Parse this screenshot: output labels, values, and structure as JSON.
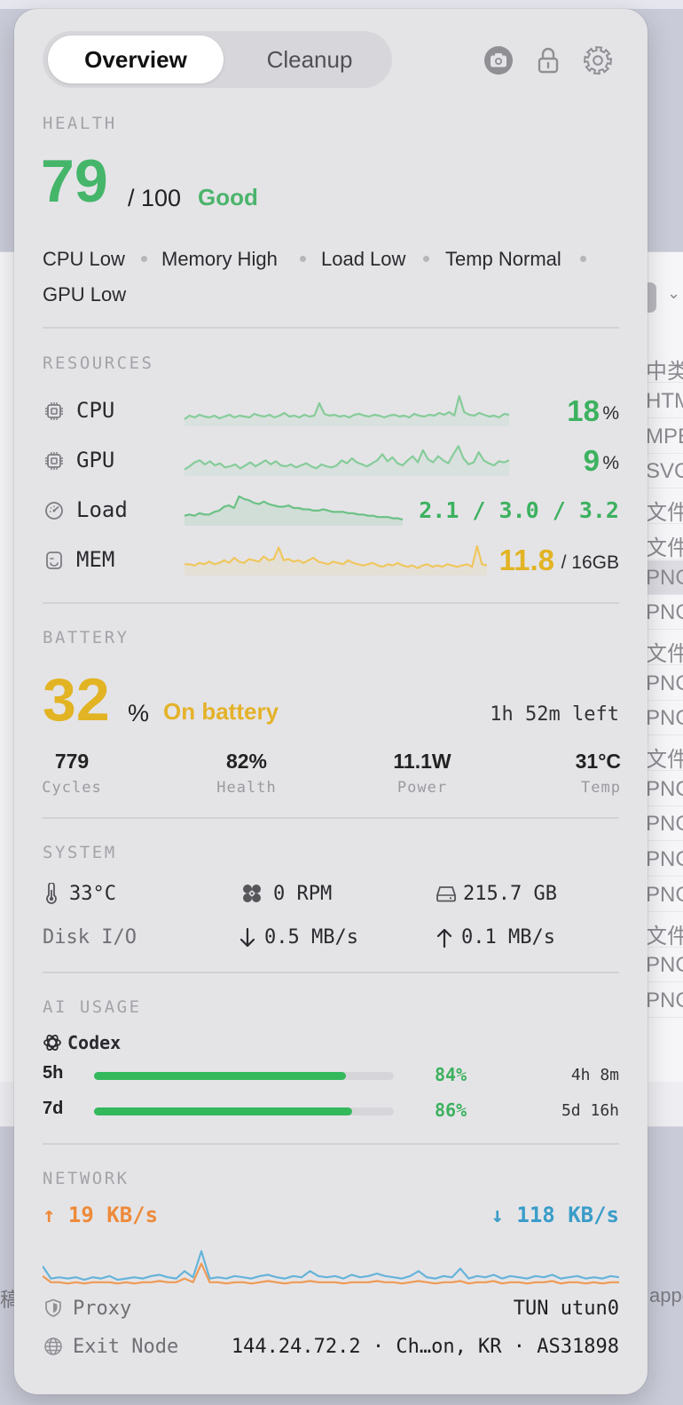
{
  "tabs": [
    {
      "label": "Overview",
      "active": true
    },
    {
      "label": "Cleanup",
      "active": false
    }
  ],
  "toolbar_icons": [
    "camera-icon",
    "lock-icon",
    "gear-icon"
  ],
  "health": {
    "section_label": "HEALTH",
    "score": "79",
    "max": "/ 100",
    "status": "Good",
    "chips": [
      "CPU Low",
      "Memory High",
      "Load Low",
      "Temp Normal",
      "GPU Low"
    ]
  },
  "resources": {
    "section_label": "RESOURCES",
    "cpu": {
      "label": "CPU",
      "value": "18",
      "unit": "%",
      "history": [
        4,
        8,
        6,
        9,
        7,
        6,
        8,
        5,
        7,
        9,
        6,
        8,
        7,
        6,
        10,
        8,
        7,
        9,
        6,
        8,
        11,
        7,
        8,
        6,
        9,
        7,
        8,
        22,
        10,
        8,
        9,
        7,
        8,
        6,
        9,
        10,
        8,
        7,
        9,
        8,
        6,
        8,
        9,
        7,
        8,
        6,
        10,
        8,
        7,
        9,
        8,
        11,
        9,
        12,
        8,
        30,
        12,
        9,
        8,
        11,
        9,
        7,
        8,
        6,
        10,
        9
      ]
    },
    "gpu": {
      "label": "GPU",
      "value": "9",
      "unit": "%",
      "history": [
        3,
        6,
        10,
        12,
        8,
        11,
        7,
        9,
        5,
        6,
        8,
        4,
        7,
        10,
        6,
        9,
        12,
        8,
        11,
        7,
        6,
        8,
        5,
        7,
        9,
        6,
        4,
        8,
        6,
        5,
        7,
        12,
        9,
        14,
        10,
        8,
        6,
        9,
        12,
        18,
        11,
        15,
        9,
        7,
        12,
        16,
        10,
        22,
        13,
        10,
        16,
        12,
        9,
        18,
        26,
        14,
        8,
        10,
        20,
        12,
        9,
        7,
        11,
        10,
        12
      ]
    },
    "load": {
      "label": "Load",
      "value": "2.1 / 3.0 / 3.2",
      "history": [
        5,
        6,
        5,
        7,
        6,
        6,
        8,
        9,
        12,
        13,
        11,
        20,
        18,
        17,
        15,
        14,
        16,
        14,
        13,
        12,
        12,
        13,
        11,
        11,
        10,
        10,
        9,
        9,
        10,
        9,
        8,
        8,
        8,
        7,
        7,
        6,
        6,
        5,
        5,
        4,
        4,
        4,
        3,
        3,
        2
      ]
    },
    "mem": {
      "label": "MEM",
      "value": "11.8",
      "unit": "/ 16GB",
      "history": [
        6,
        6,
        5,
        7,
        6,
        8,
        6,
        7,
        9,
        7,
        11,
        8,
        7,
        10,
        9,
        8,
        12,
        9,
        10,
        19,
        9,
        10,
        8,
        9,
        7,
        9,
        11,
        8,
        7,
        6,
        8,
        7,
        6,
        9,
        7,
        6,
        5,
        6,
        7,
        5,
        4,
        6,
        5,
        7,
        5,
        4,
        5,
        3,
        5,
        6,
        4,
        5,
        4,
        6,
        5,
        4,
        5,
        6,
        4,
        20,
        6,
        5
      ]
    }
  },
  "battery": {
    "section_label": "BATTERY",
    "percent": "32",
    "percent_unit": "%",
    "status": "On battery",
    "time_left": "1h 52m left",
    "stats": [
      {
        "value": "779",
        "label": "Cycles"
      },
      {
        "value": "82%",
        "label": "Health"
      },
      {
        "value": "11.1W",
        "label": "Power"
      },
      {
        "value": "31°C",
        "label": "Temp"
      }
    ]
  },
  "system": {
    "section_label": "SYSTEM",
    "temp": "33°C",
    "fan": "0 RPM",
    "disk_free": "215.7 GB",
    "disk_io_label": "Disk I/O",
    "disk_read": "0.5 MB/s",
    "disk_write": "0.1 MB/s"
  },
  "ai_usage": {
    "section_label": "AI USAGE",
    "provider": "Codex",
    "windows": [
      {
        "period": "5h",
        "percent_text": "84%",
        "percent": 84,
        "reset": "4h 8m"
      },
      {
        "period": "7d",
        "percent_text": "86%",
        "percent": 86,
        "reset": "5d 16h"
      }
    ]
  },
  "network": {
    "section_label": "NETWORK",
    "upload": "19 KB/s",
    "download": "118 KB/s",
    "down_history": [
      16,
      6,
      7,
      6,
      7,
      5,
      7,
      6,
      8,
      5,
      6,
      7,
      6,
      8,
      9,
      7,
      6,
      12,
      7,
      28,
      6,
      7,
      6,
      8,
      7,
      6,
      8,
      9,
      7,
      6,
      8,
      7,
      12,
      8,
      7,
      8,
      6,
      9,
      7,
      8,
      10,
      8,
      7,
      6,
      8,
      12,
      7,
      6,
      8,
      7,
      14,
      6,
      8,
      7,
      9,
      6,
      8,
      7,
      6,
      8,
      7,
      9,
      6,
      7,
      8,
      6,
      7,
      6,
      8,
      7
    ],
    "up_history": [
      8,
      3,
      3,
      2,
      3,
      2,
      3,
      3,
      3,
      2,
      3,
      2,
      3,
      3,
      4,
      3,
      3,
      6,
      3,
      18,
      3,
      3,
      2,
      3,
      3,
      2,
      3,
      4,
      3,
      2,
      3,
      3,
      4,
      3,
      3,
      3,
      2,
      3,
      3,
      3,
      4,
      3,
      3,
      2,
      3,
      4,
      3,
      2,
      3,
      3,
      4,
      2,
      3,
      3,
      4,
      2,
      3,
      3,
      2,
      3,
      3,
      4,
      2,
      3,
      3,
      2,
      3,
      2,
      3,
      3
    ],
    "proxy_label": "Proxy",
    "proxy_value": "TUN utun0",
    "exit_label": "Exit Node",
    "exit_value": "144.24.72.2 · Ch…on, KR · AS31898"
  },
  "background_window": {
    "column_header": "中类",
    "rows": [
      "HTM",
      "MPE",
      "SVG",
      "文件",
      "文件",
      "PNG",
      "PNG",
      "文件",
      "PNG",
      "PNG",
      "文件",
      "PNG",
      "PNG",
      "PNG",
      "PNG",
      "文件",
      "PNG",
      "PNG"
    ],
    "strip_left": "稿",
    "strip_right": "appo"
  },
  "colors": {
    "green": "#45b56a",
    "yellow": "#e2b424",
    "orange": "#ee8a3a",
    "blue": "#3a9cc8",
    "cpu_line": "#86cc99",
    "mem_line": "#efc75e",
    "panel": "#e4e4e7"
  }
}
